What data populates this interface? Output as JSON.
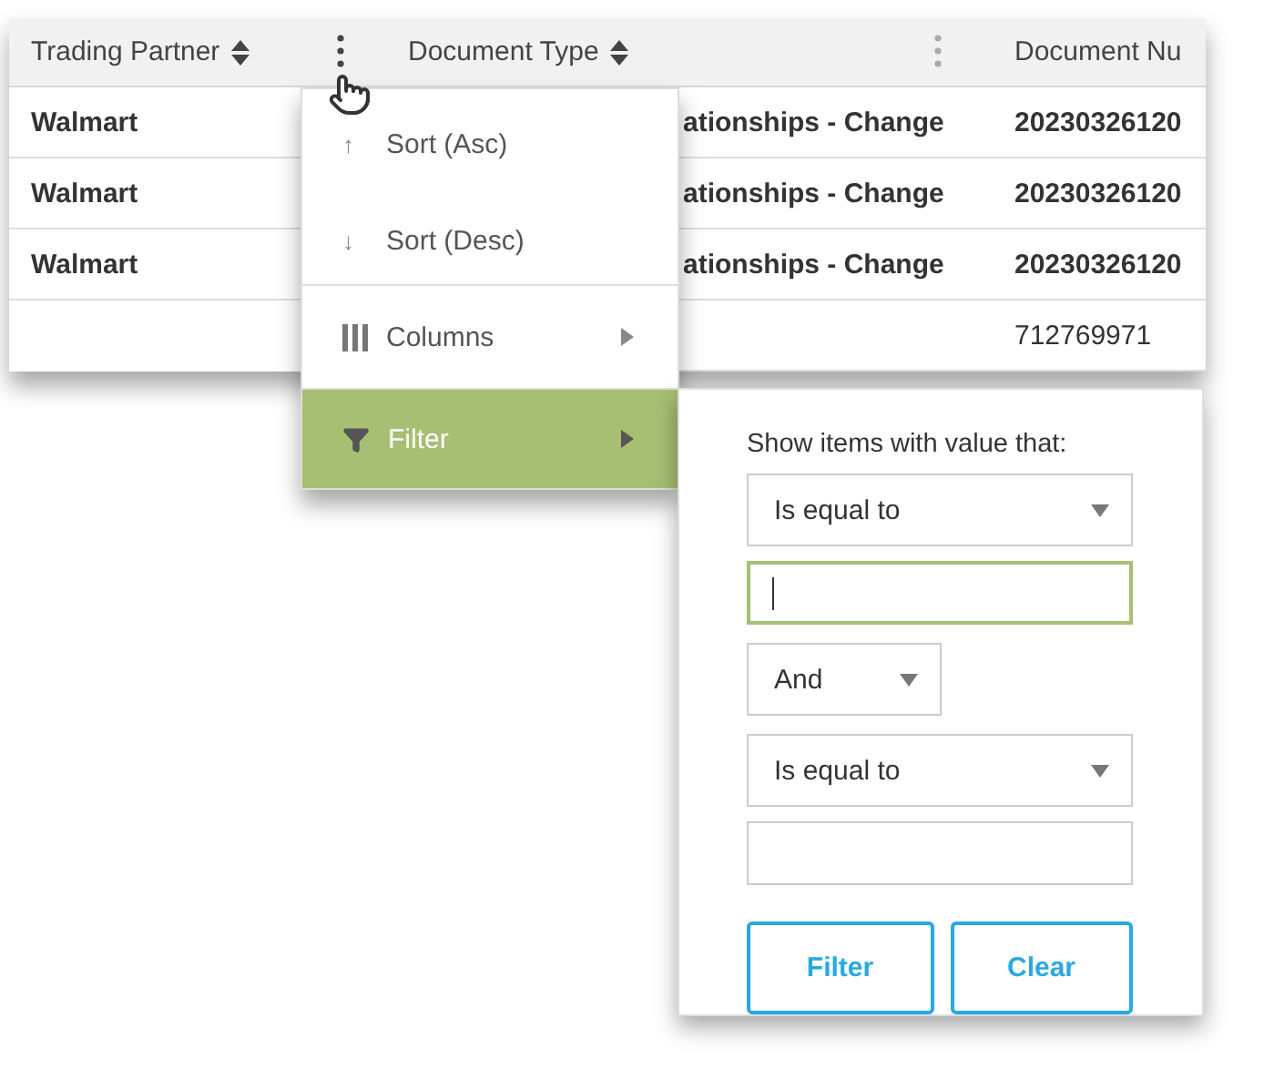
{
  "grid": {
    "columns": [
      {
        "label": "Trading Partner",
        "sortable": true,
        "menu": true
      },
      {
        "label": "Document Type",
        "sortable": true,
        "menu": true
      },
      {
        "label": "Document Nu",
        "sortable": false,
        "menu": false
      }
    ],
    "rows": [
      {
        "cells": [
          "Walmart",
          "ationships - Change",
          "20230326120"
        ]
      },
      {
        "cells": [
          "Walmart",
          "ationships - Change",
          "20230326120"
        ]
      },
      {
        "cells": [
          "Walmart",
          "ationships - Change",
          "20230326120"
        ]
      },
      {
        "cells": [
          "",
          "",
          "712769971"
        ]
      }
    ]
  },
  "column_menu": {
    "items": [
      {
        "label": "Sort (Asc)",
        "icon": "↑",
        "kind": "sort",
        "selected": false,
        "submenu": false
      },
      {
        "label": "Sort (Desc)",
        "icon": "↓",
        "kind": "sort",
        "selected": false,
        "submenu": false
      },
      {
        "label": "Columns",
        "kind": "columns",
        "selected": false,
        "submenu": true
      },
      {
        "label": "Filter",
        "kind": "filter",
        "selected": true,
        "submenu": true
      }
    ]
  },
  "filter_panel": {
    "prompt": "Show items with value that:",
    "operator_1": "Is equal to",
    "value_1": {
      "focused": true
    },
    "logic": "And",
    "operator_2": "Is equal to",
    "value_2": {
      "focused": false
    },
    "buttons": [
      "Filter",
      "Clear"
    ]
  }
}
